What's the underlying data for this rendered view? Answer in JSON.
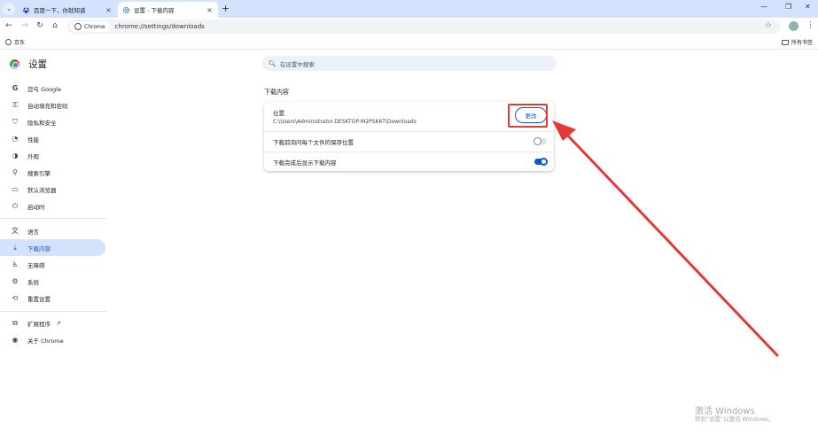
{
  "browser": {
    "tabs": [
      {
        "title": "百度一下，你就知道",
        "favicon": "baidu-paw-icon",
        "active": false
      },
      {
        "title": "设置 - 下载内容",
        "favicon": "gear-icon",
        "active": true
      }
    ],
    "chip_label": "Chrome",
    "url": "chrome://settings/downloads",
    "bookmark": "京东",
    "all_bookmarks": "所有书签"
  },
  "settings": {
    "title": "设置",
    "search_placeholder": "在设置中搜索",
    "nav": [
      {
        "label": "您与 Google",
        "icon": "google-g-icon"
      },
      {
        "label": "自动填充和密码",
        "icon": "key-icon"
      },
      {
        "label": "隐私和安全",
        "icon": "shield-icon"
      },
      {
        "label": "性能",
        "icon": "speedometer-icon"
      },
      {
        "label": "外观",
        "icon": "palette-icon"
      },
      {
        "label": "搜索引擎",
        "icon": "search-icon"
      },
      {
        "label": "默认浏览器",
        "icon": "browser-window-icon"
      },
      {
        "label": "启动时",
        "icon": "power-icon"
      },
      {
        "label": "语言",
        "icon": "translate-icon"
      },
      {
        "label": "下载内容",
        "icon": "download-icon",
        "active": true
      },
      {
        "label": "无障碍",
        "icon": "accessibility-icon"
      },
      {
        "label": "系统",
        "icon": "wrench-icon"
      },
      {
        "label": "重置设置",
        "icon": "reset-icon"
      },
      {
        "label": "扩展程序",
        "icon": "puzzle-icon"
      },
      {
        "label": "关于 Chrome",
        "icon": "chrome-icon"
      }
    ]
  },
  "downloads": {
    "section_title": "下载内容",
    "location_label": "位置",
    "location_path": "C:\\Users\\Administrator.DESKTOP-M2PSK6T\\Downloads",
    "change_button": "更改",
    "ask_label": "下载前询问每个文件的保存位置",
    "ask_enabled": false,
    "show_label": "下载完成后显示下载内容",
    "show_enabled": true
  },
  "colors": {
    "accent": "#0b57d0",
    "annotation": "#e53935",
    "active_nav": "#d3e3fd"
  },
  "watermark": {
    "line1": "激活 Windows",
    "line2": "转到\"设置\"以激活 Windows。"
  }
}
